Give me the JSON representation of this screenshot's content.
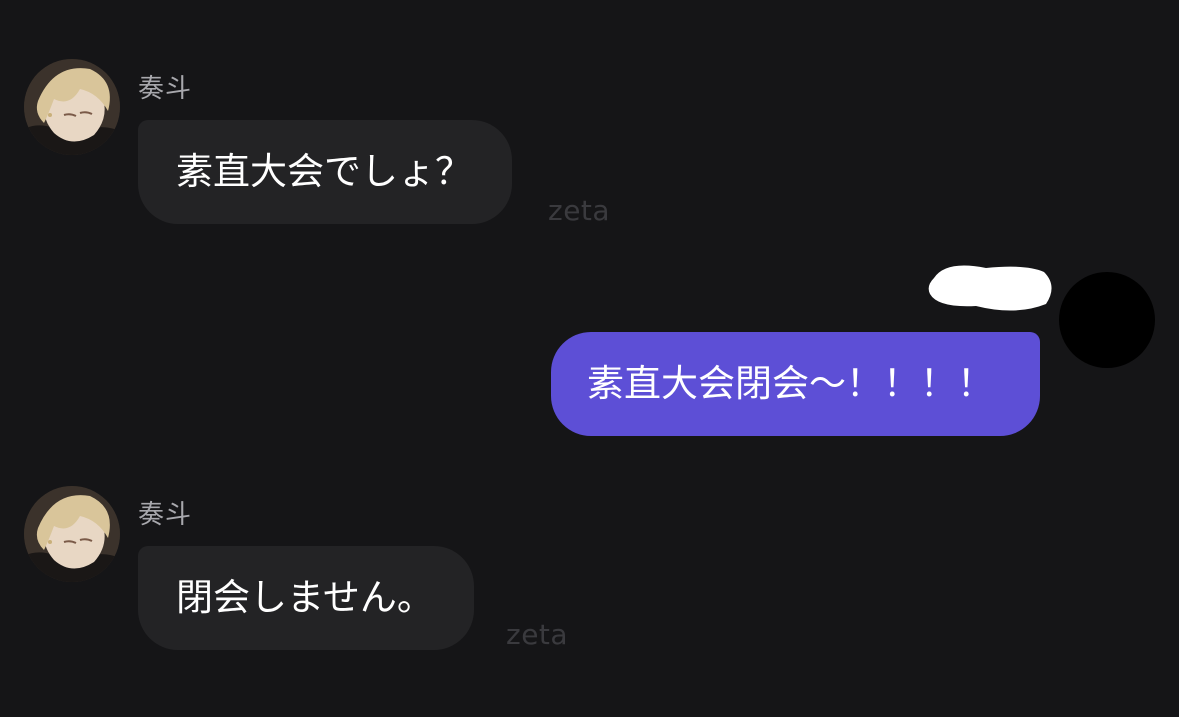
{
  "messages": [
    {
      "sender": "奏斗",
      "text": "素直大会でしょ？",
      "watermark": "zeta"
    },
    {
      "text": "素直大会閉会〜！！！！"
    },
    {
      "sender": "奏斗",
      "text": "閉会しません。",
      "watermark": "zeta"
    }
  ],
  "colors": {
    "background": "#151517",
    "incoming_bubble": "#232325",
    "outgoing_bubble": "#5d4fd6",
    "sender_name": "#a8a8ad",
    "watermark": "#3a3a3e"
  },
  "icons": {
    "bot_avatar": "character-avatar-icon",
    "user_avatar": "user-avatar-icon"
  }
}
